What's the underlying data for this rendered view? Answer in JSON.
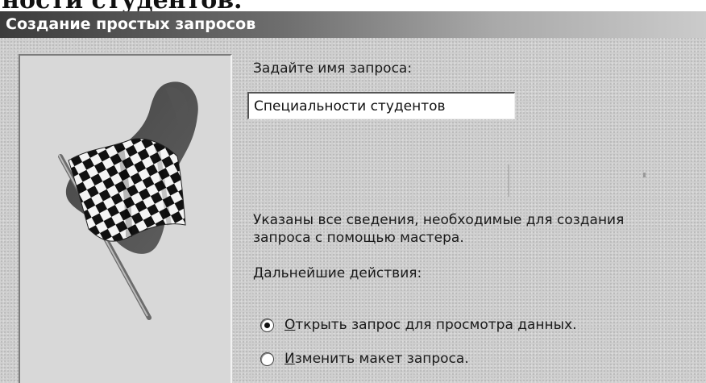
{
  "document": {
    "heading": "ности студентов."
  },
  "dialog": {
    "title": "Создание простых запросов",
    "query_name_label": "Задайте имя запроса:",
    "query_name_value": "Специальности студентов",
    "info_line1": "Указаны все сведения, необходимые для создания",
    "info_line2": "запроса с помощью мастера.",
    "next_actions_label": "Дальнейшие действия:",
    "options": [
      {
        "accel": "О",
        "rest": "ткрыть запрос для просмотра данных.",
        "selected": true
      },
      {
        "accel": "И",
        "rest": "зменить макет запроса.",
        "selected": false
      }
    ]
  },
  "icons": {
    "wizard_image": "checkered-flag-icon"
  },
  "colors": {
    "dialog_background": "#cfcfcf",
    "titlebar_start": "#3c3c3c",
    "titlebar_end": "#cbcbcb",
    "title_text": "#ffffff"
  }
}
